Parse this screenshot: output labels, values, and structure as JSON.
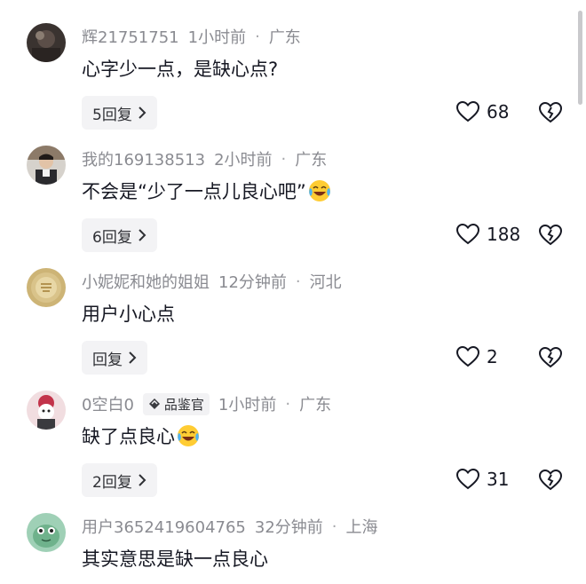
{
  "comments": [
    {
      "user": "辉21751751",
      "time": "1小时前",
      "location": "广东",
      "text": "心字少一点，是缺心点?",
      "reply_label": "5回复",
      "likes": "68",
      "has_emoji": false,
      "badge": ""
    },
    {
      "user": "我的169138513",
      "time": "2小时前",
      "location": "广东",
      "text": "不会是“少了一点儿良心吧”",
      "reply_label": "6回复",
      "likes": "188",
      "has_emoji": true,
      "badge": ""
    },
    {
      "user": "小妮妮和她的姐姐",
      "time": "12分钟前",
      "location": "河北",
      "text": "用户小心点",
      "reply_label": "回复",
      "likes": "2",
      "has_emoji": false,
      "badge": ""
    },
    {
      "user": "0空白0",
      "time": "1小时前",
      "location": "广东",
      "text": "缺了点良心",
      "reply_label": "2回复",
      "likes": "31",
      "has_emoji": true,
      "badge": "品鉴官"
    },
    {
      "user": "用户3652419604765",
      "time": "32分钟前",
      "location": "上海",
      "text": "其实意思是缺一点良心",
      "reply_label": "",
      "likes": "",
      "has_emoji": false,
      "badge": ""
    }
  ],
  "separator": "·",
  "icons": {
    "like": "heart-outline-icon",
    "dislike": "broken-heart-icon",
    "chevron": "chevron-right-icon",
    "emoji": "laughing-crying-emoji"
  }
}
